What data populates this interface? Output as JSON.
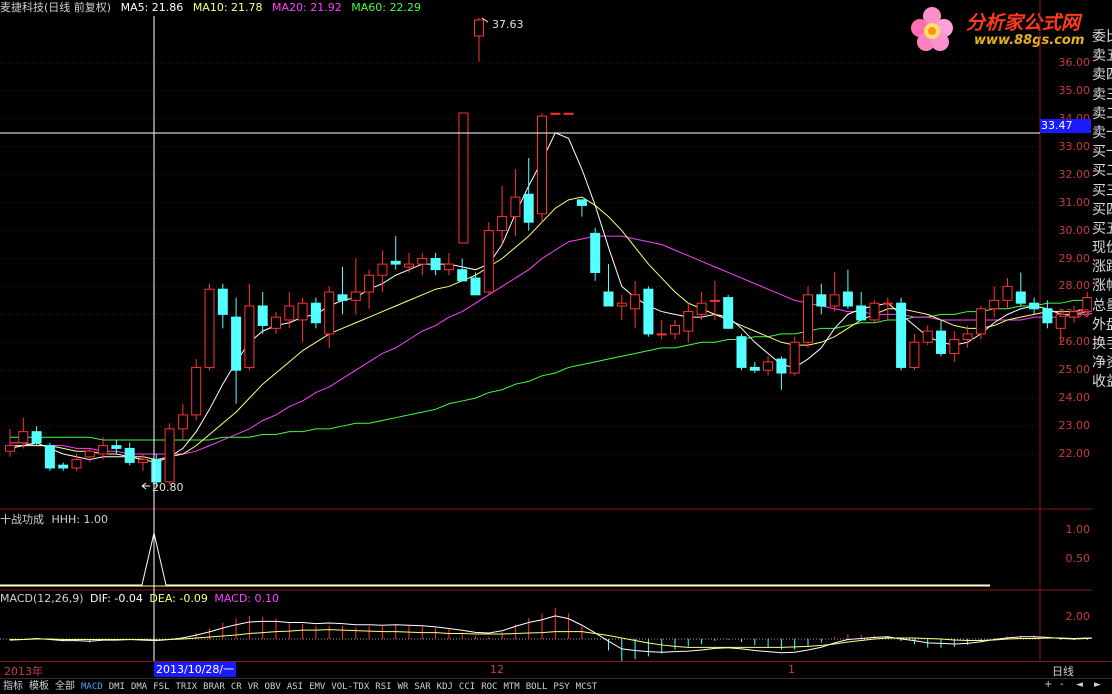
{
  "header": {
    "title": "麦捷科技(日线 前复权)",
    "ma5": "MA5: 21.86",
    "ma10": "MA10: 21.78",
    "ma20": "MA20: 21.92",
    "ma60": "MA60: 22.29"
  },
  "logo": {
    "main": "分析家公式网",
    "sub": "www.88gs.com"
  },
  "price_axis": {
    "ticks": [
      "36.00",
      "35.00",
      "34.00",
      "33.00",
      "32.00",
      "31.00",
      "30.00",
      "29.00",
      "28.00",
      "27.00",
      "26.00",
      "25.00",
      "24.00",
      "23.00",
      "22.00"
    ],
    "crosshair_value": "33.47"
  },
  "annotations": {
    "high": "37.63",
    "low": "20.80"
  },
  "right_panel": [
    "委比",
    "卖五",
    "卖四",
    "卖三",
    "卖二",
    "卖一",
    "买一",
    "买二",
    "买三",
    "买四",
    "买五",
    "现价",
    "涨跌",
    "涨幅",
    "总量",
    "外盘",
    "换手",
    "净资",
    "收益"
  ],
  "indicator1": {
    "title": "十战功成",
    "value": "HHH: 1.00",
    "ticks": [
      "1.00",
      "0.50"
    ]
  },
  "indicator2": {
    "title": "MACD(12,26,9)",
    "dif": "DIF: -0.04",
    "dea": "DEA: -0.09",
    "macd": "MACD: 0.10",
    "ticks": [
      "2.00"
    ]
  },
  "xaxis": {
    "year": "2013年",
    "cursor_date": "2013/10/28/一",
    "month12": "12",
    "month1": "1",
    "period": "日线"
  },
  "tabs": [
    "指标",
    "模板",
    "全部",
    "MACD",
    "DMI",
    "DMA",
    "FSL",
    "TRIX",
    "BRAR",
    "CR",
    "VR",
    "OBV",
    "ASI",
    "EMV",
    "VOL-TDX",
    "RSI",
    "WR",
    "SAR",
    "KDJ",
    "CCI",
    "ROC",
    "MTM",
    "BOLL",
    "PSY",
    "MCST"
  ],
  "active_tab": "MACD",
  "colors": {
    "up": "#ff3232",
    "down": "#54ffff",
    "ma5": "#ffffff",
    "ma10": "#ffff80",
    "ma20": "#ff40ff",
    "ma60": "#40ff40",
    "axis": "#8b1a1a"
  },
  "candles": [
    [
      22.1,
      22.9,
      21.9,
      22.3
    ],
    [
      22.4,
      23.3,
      22.2,
      22.8
    ],
    [
      22.8,
      23.0,
      22.3,
      22.4
    ],
    [
      22.3,
      22.4,
      21.4,
      21.5
    ],
    [
      21.6,
      21.7,
      21.4,
      21.5
    ],
    [
      21.5,
      22.0,
      21.4,
      21.8
    ],
    [
      21.9,
      22.2,
      21.7,
      22.1
    ],
    [
      22.0,
      22.6,
      21.8,
      22.3
    ],
    [
      22.3,
      22.5,
      22.0,
      22.2
    ],
    [
      22.2,
      22.4,
      21.6,
      21.7
    ],
    [
      21.7,
      22.0,
      21.4,
      21.8
    ],
    [
      21.8,
      22.0,
      20.8,
      21.0
    ],
    [
      21.0,
      23.1,
      20.9,
      22.9
    ],
    [
      22.9,
      23.8,
      22.5,
      23.4
    ],
    [
      23.4,
      25.4,
      23.2,
      25.1
    ],
    [
      25.1,
      28.1,
      25.0,
      27.9
    ],
    [
      27.9,
      28.1,
      26.5,
      27.0
    ],
    [
      26.9,
      27.6,
      23.8,
      25.0
    ],
    [
      25.1,
      28.1,
      25.0,
      27.3
    ],
    [
      27.3,
      27.8,
      26.3,
      26.6
    ],
    [
      26.5,
      27.1,
      26.3,
      26.9
    ],
    [
      26.8,
      27.8,
      26.5,
      27.3
    ],
    [
      26.8,
      27.6,
      26.0,
      27.4
    ],
    [
      27.4,
      27.6,
      26.5,
      26.7
    ],
    [
      26.3,
      28.0,
      25.8,
      27.8
    ],
    [
      27.7,
      28.7,
      27.0,
      27.5
    ],
    [
      27.5,
      29.0,
      27.0,
      27.8
    ],
    [
      27.8,
      28.6,
      27.2,
      28.4
    ],
    [
      28.4,
      29.3,
      27.8,
      28.8
    ],
    [
      28.9,
      29.8,
      28.6,
      28.8
    ],
    [
      28.7,
      29.2,
      28.5,
      28.8
    ],
    [
      28.8,
      29.2,
      28.4,
      29.0
    ],
    [
      29.0,
      29.2,
      28.4,
      28.6
    ],
    [
      28.6,
      29.2,
      28.4,
      28.8
    ],
    [
      28.6,
      29.0,
      28.2,
      28.2
    ],
    [
      28.3,
      28.5,
      27.7,
      27.7
    ],
    [
      27.8,
      30.3,
      27.7,
      30.0
    ],
    [
      30.0,
      31.6,
      29.5,
      30.5
    ],
    [
      30.5,
      32.2,
      29.8,
      31.2
    ],
    [
      31.3,
      32.6,
      30.0,
      30.3
    ],
    [
      30.6,
      34.2,
      30.3,
      34.1
    ],
    [
      34.2,
      34.2,
      34.2,
      34.2
    ],
    [
      34.2,
      34.2,
      34.2,
      34.2
    ],
    [
      31.1,
      31.1,
      30.5,
      30.9
    ],
    [
      29.9,
      30.1,
      28.2,
      28.5
    ],
    [
      27.8,
      28.8,
      27.3,
      27.3
    ],
    [
      27.3,
      27.7,
      26.8,
      27.4
    ],
    [
      27.2,
      28.2,
      26.5,
      27.7
    ],
    [
      27.9,
      28.0,
      26.2,
      26.3
    ],
    [
      26.3,
      26.8,
      26.1,
      26.3
    ],
    [
      26.3,
      26.8,
      26.1,
      26.6
    ],
    [
      26.4,
      27.4,
      26.0,
      27.1
    ],
    [
      27.0,
      27.8,
      26.8,
      27.4
    ],
    [
      27.5,
      28.2,
      26.8,
      27.5
    ],
    [
      27.6,
      27.7,
      26.5,
      26.5
    ],
    [
      26.2,
      26.3,
      25.0,
      25.1
    ],
    [
      25.1,
      25.3,
      24.9,
      25.0
    ],
    [
      25.0,
      25.5,
      24.8,
      25.3
    ],
    [
      25.4,
      25.5,
      24.3,
      24.9
    ],
    [
      24.9,
      26.2,
      24.8,
      26.0
    ],
    [
      26.0,
      28.0,
      25.8,
      27.7
    ],
    [
      27.7,
      28.1,
      27.0,
      27.3
    ],
    [
      27.3,
      28.5,
      27.1,
      27.7
    ],
    [
      27.8,
      28.6,
      27.2,
      27.3
    ],
    [
      27.3,
      27.8,
      26.8,
      26.8
    ],
    [
      26.8,
      27.5,
      26.7,
      27.4
    ],
    [
      27.4,
      27.6,
      26.8,
      27.4
    ],
    [
      27.4,
      27.6,
      25.0,
      25.1
    ],
    [
      25.1,
      26.3,
      25.0,
      26.0
    ],
    [
      26.0,
      26.6,
      25.9,
      26.4
    ],
    [
      26.4,
      26.8,
      25.5,
      25.6
    ],
    [
      25.6,
      26.4,
      25.3,
      26.1
    ],
    [
      26.1,
      26.6,
      25.8,
      26.3
    ],
    [
      26.3,
      27.3,
      26.1,
      27.2
    ],
    [
      27.2,
      28.0,
      26.9,
      27.5
    ],
    [
      27.5,
      28.3,
      27.2,
      28.0
    ],
    [
      27.8,
      28.5,
      27.3,
      27.4
    ],
    [
      27.4,
      27.6,
      27.0,
      27.2
    ],
    [
      27.2,
      27.5,
      26.5,
      26.7
    ],
    [
      26.5,
      27.2,
      26.0,
      27.0
    ],
    [
      26.9,
      27.3,
      26.7,
      27.1
    ],
    [
      27.1,
      27.8,
      26.9,
      27.6
    ],
    [
      27.5,
      29.0,
      27.3,
      28.8
    ]
  ],
  "ma5_line": [
    22.2,
    22.3,
    22.4,
    22.2,
    22.0,
    21.9,
    21.8,
    21.9,
    21.9,
    21.9,
    21.8,
    21.7,
    21.9,
    22.2,
    22.8,
    23.6,
    24.5,
    25.3,
    26.0,
    26.4,
    26.6,
    26.7,
    26.9,
    27.0,
    27.3,
    27.5,
    27.6,
    27.9,
    28.1,
    28.4,
    28.6,
    28.8,
    28.8,
    28.8,
    28.7,
    28.6,
    28.8,
    29.5,
    30.6,
    31.6,
    32.5,
    33.5,
    33.3,
    32.2,
    30.9,
    29.4,
    28.0,
    27.6,
    27.3,
    27.1,
    27.0,
    26.9,
    26.9,
    27.0,
    26.9,
    26.5,
    26.0,
    25.6,
    25.2,
    25.1,
    25.4,
    25.8,
    26.5,
    27.0,
    27.2,
    27.3,
    27.4,
    27.0,
    26.6,
    26.2,
    26.0,
    25.9,
    26.0,
    26.3,
    26.7,
    27.0,
    27.2,
    27.3,
    27.2,
    27.0,
    27.0,
    27.1,
    27.4
  ],
  "ma10_line": [
    22.3,
    22.3,
    22.3,
    22.3,
    22.2,
    22.1,
    22.1,
    22.0,
    22.0,
    21.9,
    21.9,
    21.8,
    21.9,
    22.0,
    22.3,
    22.7,
    23.1,
    23.5,
    24.0,
    24.5,
    24.9,
    25.3,
    25.7,
    26.0,
    26.3,
    26.5,
    26.7,
    26.9,
    27.1,
    27.3,
    27.5,
    27.7,
    27.9,
    28.0,
    28.2,
    28.4,
    28.7,
    29.0,
    29.4,
    29.8,
    30.3,
    30.8,
    31.1,
    31.2,
    30.9,
    30.5,
    30.0,
    29.4,
    28.8,
    28.3,
    27.8,
    27.4,
    27.2,
    27.0,
    26.8,
    26.6,
    26.4,
    26.2,
    26.0,
    25.9,
    25.9,
    26.0,
    26.2,
    26.5,
    26.8,
    27.0,
    27.2,
    27.2,
    27.1,
    27.0,
    26.8,
    26.6,
    26.5,
    26.5,
    26.6,
    26.8,
    26.9,
    27.0,
    27.1,
    27.1,
    27.1,
    27.2,
    27.3
  ],
  "ma20_line": [
    22.4,
    22.4,
    22.3,
    22.3,
    22.3,
    22.2,
    22.2,
    22.1,
    22.1,
    22.0,
    22.0,
    22.0,
    22.0,
    22.0,
    22.1,
    22.3,
    22.5,
    22.7,
    22.9,
    23.2,
    23.4,
    23.7,
    23.9,
    24.2,
    24.4,
    24.7,
    25.0,
    25.3,
    25.6,
    25.8,
    26.1,
    26.4,
    26.6,
    26.9,
    27.1,
    27.4,
    27.7,
    28.0,
    28.3,
    28.6,
    29.0,
    29.3,
    29.6,
    29.7,
    29.8,
    29.8,
    29.8,
    29.7,
    29.6,
    29.5,
    29.3,
    29.1,
    28.9,
    28.7,
    28.5,
    28.3,
    28.1,
    27.9,
    27.7,
    27.5,
    27.4,
    27.3,
    27.2,
    27.1,
    27.1,
    27.0,
    27.0,
    27.0,
    26.9,
    26.9,
    26.8,
    26.8,
    26.8,
    26.8,
    26.8,
    26.8,
    26.8,
    26.9,
    26.9,
    26.9,
    27.0,
    27.0,
    27.1
  ],
  "ma60_line": [
    22.6,
    22.6,
    22.6,
    22.6,
    22.6,
    22.6,
    22.6,
    22.5,
    22.5,
    22.5,
    22.5,
    22.5,
    22.5,
    22.5,
    22.5,
    22.5,
    22.6,
    22.6,
    22.6,
    22.7,
    22.7,
    22.8,
    22.8,
    22.9,
    22.9,
    23.0,
    23.1,
    23.1,
    23.2,
    23.3,
    23.4,
    23.5,
    23.6,
    23.8,
    23.9,
    24.0,
    24.2,
    24.3,
    24.5,
    24.6,
    24.8,
    24.9,
    25.1,
    25.2,
    25.3,
    25.4,
    25.5,
    25.6,
    25.7,
    25.8,
    25.8,
    25.9,
    26.0,
    26.0,
    26.1,
    26.1,
    26.2,
    26.2,
    26.3,
    26.3,
    26.4,
    26.5,
    26.5,
    26.6,
    26.7,
    26.7,
    26.8,
    26.8,
    26.9,
    26.9,
    27.0,
    27.0,
    27.1,
    27.1,
    27.2,
    27.2,
    27.3,
    27.3,
    27.4,
    27.4,
    27.5,
    27.5,
    27.6
  ]
}
